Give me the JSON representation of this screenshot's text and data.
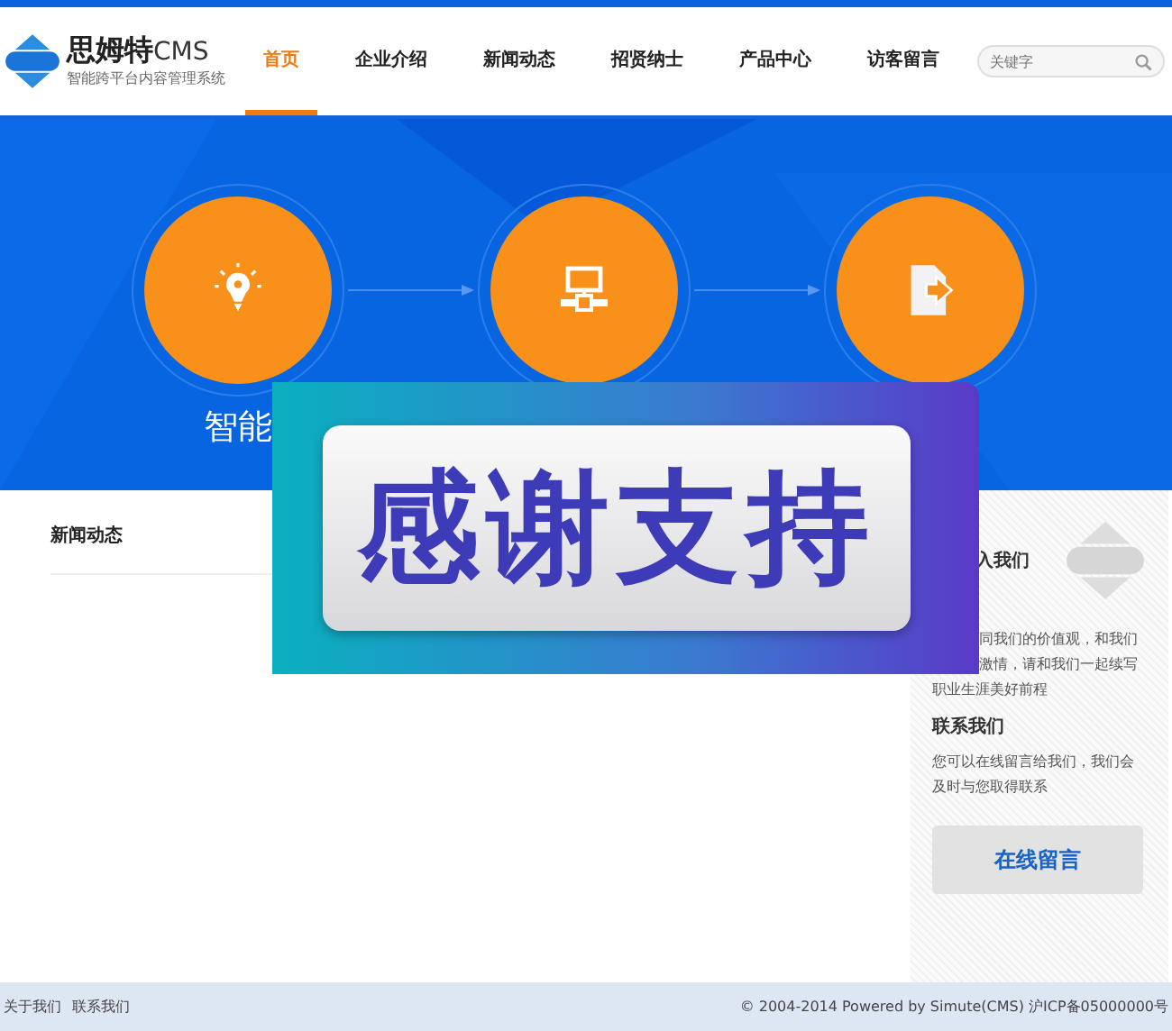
{
  "logo": {
    "name": "思姆特",
    "suffix": "CMS",
    "tagline": "智能跨平台内容管理系统"
  },
  "nav": [
    {
      "label": "首页",
      "selected": true
    },
    {
      "label": "企业介绍",
      "selected": false
    },
    {
      "label": "新闻动态",
      "selected": false
    },
    {
      "label": "招贤纳士",
      "selected": false
    },
    {
      "label": "产品中心",
      "selected": false
    },
    {
      "label": "访客留言",
      "selected": false
    }
  ],
  "search": {
    "placeholder": "关键字"
  },
  "feature_labels": [
    "智能"
  ],
  "news": {
    "title": "新闻动态"
  },
  "sidebar": {
    "join_title": "入我们",
    "join_lines": [
      "同我们的价值观，和我们",
      "激情，请和我们一起续写",
      "职业生涯美好前程"
    ],
    "contact_title": "联系我们",
    "contact_text": "您可以在线留言给我们，我们会及时与您取得联系",
    "button": "在线留言"
  },
  "overlay": {
    "text": "感谢支持"
  },
  "footer": {
    "links": [
      "关于我们",
      "联系我们"
    ],
    "copyright": "© 2004-2014 Powered by Simute(CMS)  沪ICP备05000000号"
  }
}
